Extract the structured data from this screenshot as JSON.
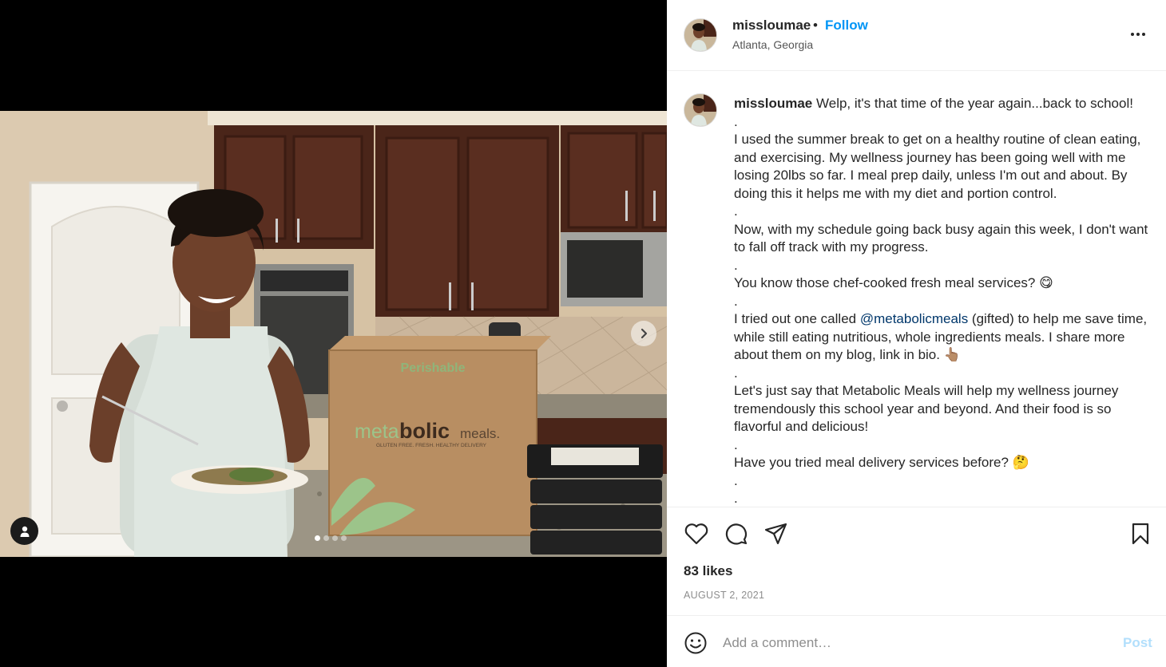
{
  "post": {
    "username": "missloumae",
    "separator": "•",
    "follow_label": "Follow",
    "location": "Atlanta, Georgia",
    "more_icon": "more-horizontal-icon"
  },
  "media": {
    "box_label_top": "Perishable",
    "box_brand_meta": "meta",
    "box_brand_bolic": "bolic",
    "box_brand_meals": "meals.",
    "box_tagline": "GLUTEN FREE. FRESH. HEALTHY DELIVERY",
    "carousel_slides": 4,
    "carousel_active": 1,
    "next_icon": "chevron-right-icon",
    "user_tag_icon": "user-tag-icon"
  },
  "caption": {
    "username": "missloumae",
    "lines": [
      "Welp, it's that time of the year again...back to school!",
      ".",
      "I used the summer break to get on a healthy routine of clean eating, and exercising. My wellness journey has been going well with me losing 20lbs so far. I meal prep daily, unless I'm out and about. By doing this it helps me with my diet and portion control.",
      ".",
      "Now, with my schedule going back busy again this week, I don't want to fall off track with my progress.",
      ".",
      "You know those chef-cooked fresh meal services? 😋",
      "."
    ],
    "mention_before": "I tried out one called ",
    "mention": "@metabolicmeals",
    "mention_after": " (gifted) to help me save time, while still eating nutritious, whole ingredients meals. I share more about them on my blog, link in bio. 👆🏽",
    "lines_after": [
      ".",
      "Let's just say that Metabolic Meals will help my wellness journey tremendously this school year and beyond. And their food is so flavorful and delicious!",
      ".",
      "Have you tried meal delivery services before? 🤔",
      ".",
      "."
    ]
  },
  "actions": {
    "like_icon": "heart-icon",
    "comment_icon": "comment-icon",
    "share_icon": "share-icon",
    "save_icon": "bookmark-icon",
    "likes_text": "83 likes",
    "date": "AUGUST 2, 2021"
  },
  "comment": {
    "emoji_icon": "emoji-icon",
    "placeholder": "Add a comment…",
    "post_label": "Post"
  },
  "colors": {
    "link_blue": "#0095f6",
    "mention_blue": "#00376b",
    "post_disabled": "#b2dffc",
    "muted": "#8e8e8e"
  }
}
